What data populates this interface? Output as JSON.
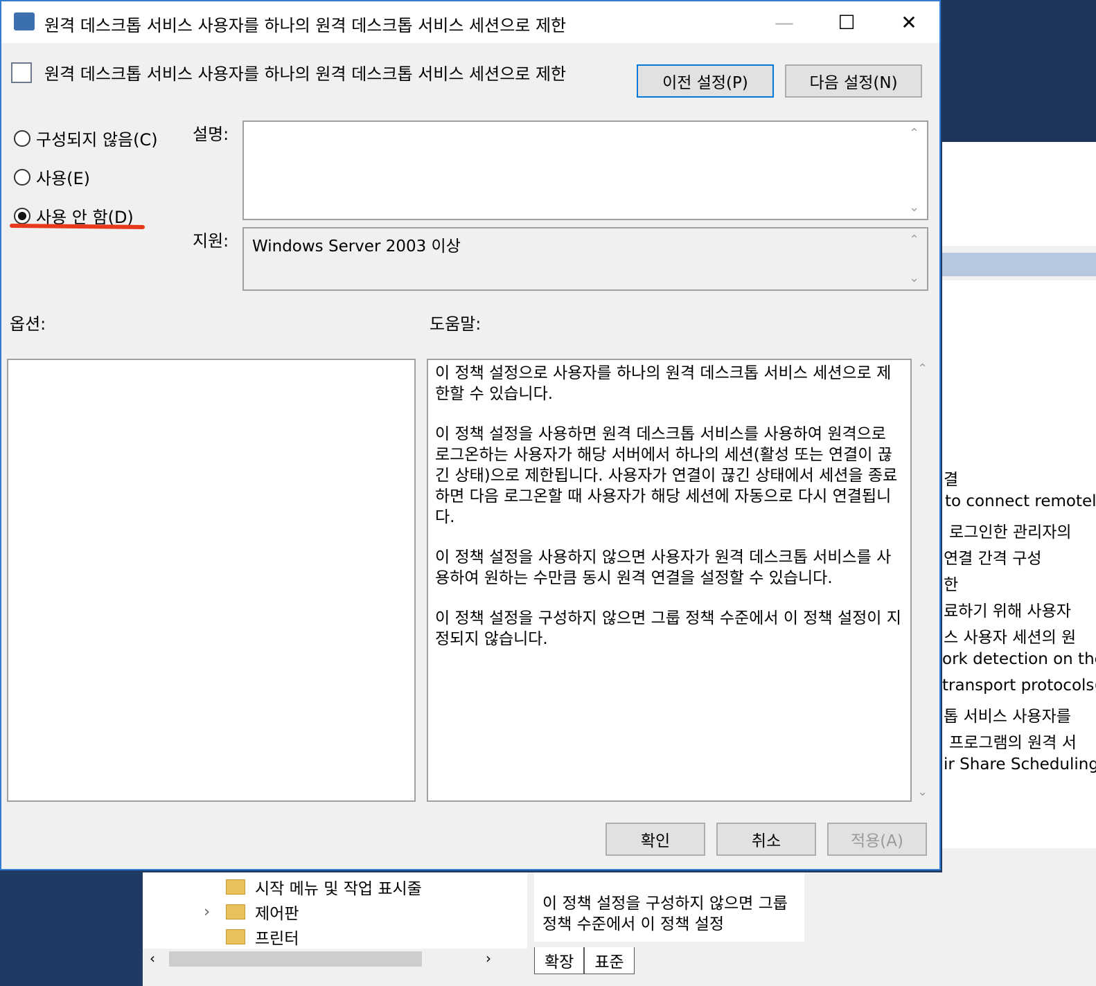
{
  "window": {
    "title": "원격 데스크톱 서비스 사용자를 하나의 원격 데스크톱 서비스 세션으로 제한",
    "minimize_glyph": "—",
    "maximize_glyph": "☐",
    "close_glyph": "✕"
  },
  "header": {
    "policy_name": "원격 데스크톱 서비스 사용자를 하나의 원격 데스크톱 서비스 세션으로 제한",
    "prev_label": "이전 설정(P)",
    "next_label": "다음 설정(N)"
  },
  "state": {
    "options": [
      {
        "label": "구성되지 않음(C)",
        "checked": false
      },
      {
        "label": "사용(E)",
        "checked": false
      },
      {
        "label": "사용 안 함(D)",
        "checked": true
      }
    ]
  },
  "description": {
    "label": "설명:",
    "text": ""
  },
  "supported": {
    "label": "지원:",
    "text": "Windows Server 2003 이상"
  },
  "options_label": "옵션:",
  "help": {
    "label": "도움말:",
    "paragraphs": [
      "이 정책 설정으로 사용자를 하나의 원격 데스크톱 서비스 세션으로 제한할 수 있습니다.",
      "이 정책 설정을 사용하면 원격 데스크톱 서비스를 사용하여 원격으로 로그온하는 사용자가 해당 서버에서 하나의 세션(활성 또는 연결이 끊긴 상태)으로 제한됩니다. 사용자가 연결이 끊긴 상태에서 세션을 종료하면 다음 로그온할 때 사용자가 해당 세션에 자동으로 다시 연결됩니다.",
      "이 정책 설정을 사용하지 않으면 사용자가 원격 데스크톱 서비스를 사용하여 원하는 수만큼 동시 원격 연결을 설정할 수 있습니다.",
      "이 정책 설정을 구성하지 않으면 그룹 정책 수준에서 이 정책 설정이 지정되지 않습니다."
    ]
  },
  "footer": {
    "ok_label": "확인",
    "cancel_label": "취소",
    "apply_label": "적용(A)"
  },
  "background": {
    "right_list": [
      "결",
      "to connect remotel",
      "로그인한 관리자의",
      "연결 간격 구성",
      "한",
      "료하기 위해 사용자",
      "스 사용자 세션의 원",
      "ork detection on the",
      "transport protocols(",
      "톱 서비스 사용자를",
      "프로그램의 원격 서",
      "ir Share Scheduling"
    ],
    "tree_items": [
      "시작 메뉴 및 작업 표시줄",
      "제어판",
      "프린터"
    ],
    "help_snippet": "이 정책 설정을 구성하지 않으면 그룹 정책 수준에서 이 정책 설정",
    "tabs": [
      "확장",
      "표준"
    ]
  }
}
